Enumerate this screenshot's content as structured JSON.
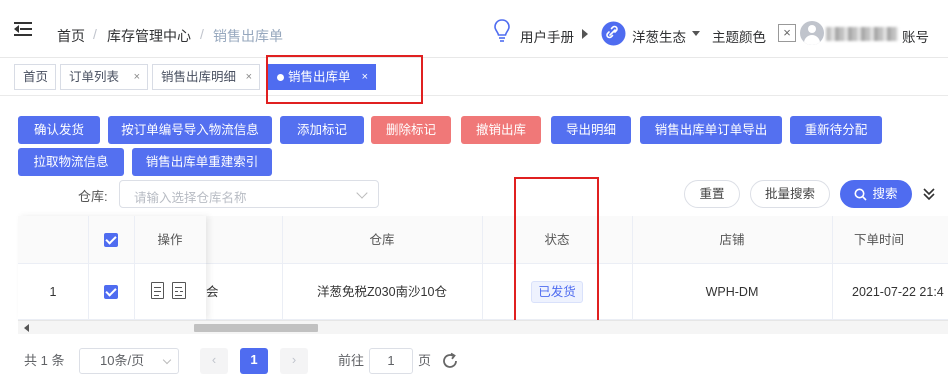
{
  "breadcrumb": [
    "首页",
    "库存管理中心",
    "销售出库单"
  ],
  "header": {
    "manual": "用户手册",
    "ecosystem": "洋葱生态",
    "theme": "主题颜色",
    "account": "账号"
  },
  "tabs": [
    {
      "label": "首页",
      "active": false
    },
    {
      "label": "订单列表",
      "active": false,
      "close": "×"
    },
    {
      "label": "销售出库明细",
      "active": false,
      "close": "×"
    },
    {
      "label": "销售出库单",
      "active": true,
      "close": "×"
    }
  ],
  "actions_row1": [
    "确认发货",
    "按订单编号导入物流信息",
    "添加标记",
    "删除标记",
    "撤销出库",
    "导出明细",
    "销售出库单订单导出",
    "重新待分配"
  ],
  "actions_row2": [
    "拉取物流信息",
    "销售出库单重建索引"
  ],
  "filter": {
    "label": "仓库:",
    "placeholder": "请输入选择仓库名称"
  },
  "filter_buttons": {
    "reset": "重置",
    "batch": "批量搜索",
    "search": "搜索"
  },
  "table": {
    "headers": {
      "ops": "操作",
      "warehouse": "仓库",
      "status": "状态",
      "shop": "店铺",
      "time": "下单时间"
    },
    "row": {
      "index": "1",
      "hidden_text": "会",
      "warehouse": "洋葱免税Z030南沙10仓",
      "status": "已发货",
      "shop": "WPH-DM",
      "time": "2021-07-22 21:4"
    }
  },
  "pagination": {
    "total": "共 1 条",
    "page_size": "10条/页",
    "current": "1",
    "goto_label": "前往",
    "goto_value": "1",
    "page_unit": "页"
  },
  "colors": {
    "primary": "#4f6cf0",
    "danger": "#f07878",
    "highlight": "#e02020"
  }
}
